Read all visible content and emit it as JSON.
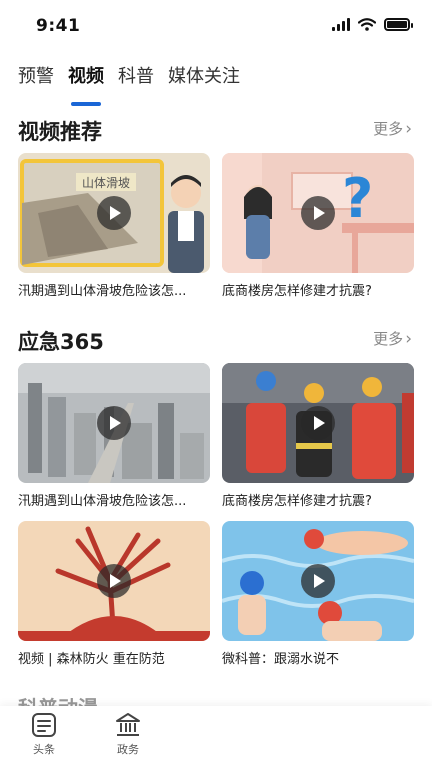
{
  "status_bar": {
    "time": "9:41"
  },
  "tabs": [
    {
      "label": "预警"
    },
    {
      "label": "视频"
    },
    {
      "label": "科普"
    },
    {
      "label": "媒体关注"
    }
  ],
  "sections": {
    "video_recommend": {
      "title": "视频推荐",
      "more": "更多",
      "cards": [
        {
          "title": "汛期遇到山体滑坡危险该怎...",
          "thumb_text": "山体滑坡"
        },
        {
          "title": "底商楼房怎样修建才抗震?"
        }
      ]
    },
    "emergency365": {
      "title": "应急365",
      "more": "更多",
      "cards": [
        {
          "title": "汛期遇到山体滑坡危险该怎..."
        },
        {
          "title": "底商楼房怎样修建才抗震?"
        },
        {
          "title": "视频 | 森林防火 重在防范"
        },
        {
          "title": "微科普：跟溺水说不"
        }
      ]
    },
    "next": {
      "title": "科普动漫"
    }
  },
  "bottom_nav": [
    {
      "label": "头条",
      "icon": "news-icon"
    },
    {
      "label": "政务",
      "icon": "government-icon"
    }
  ]
}
